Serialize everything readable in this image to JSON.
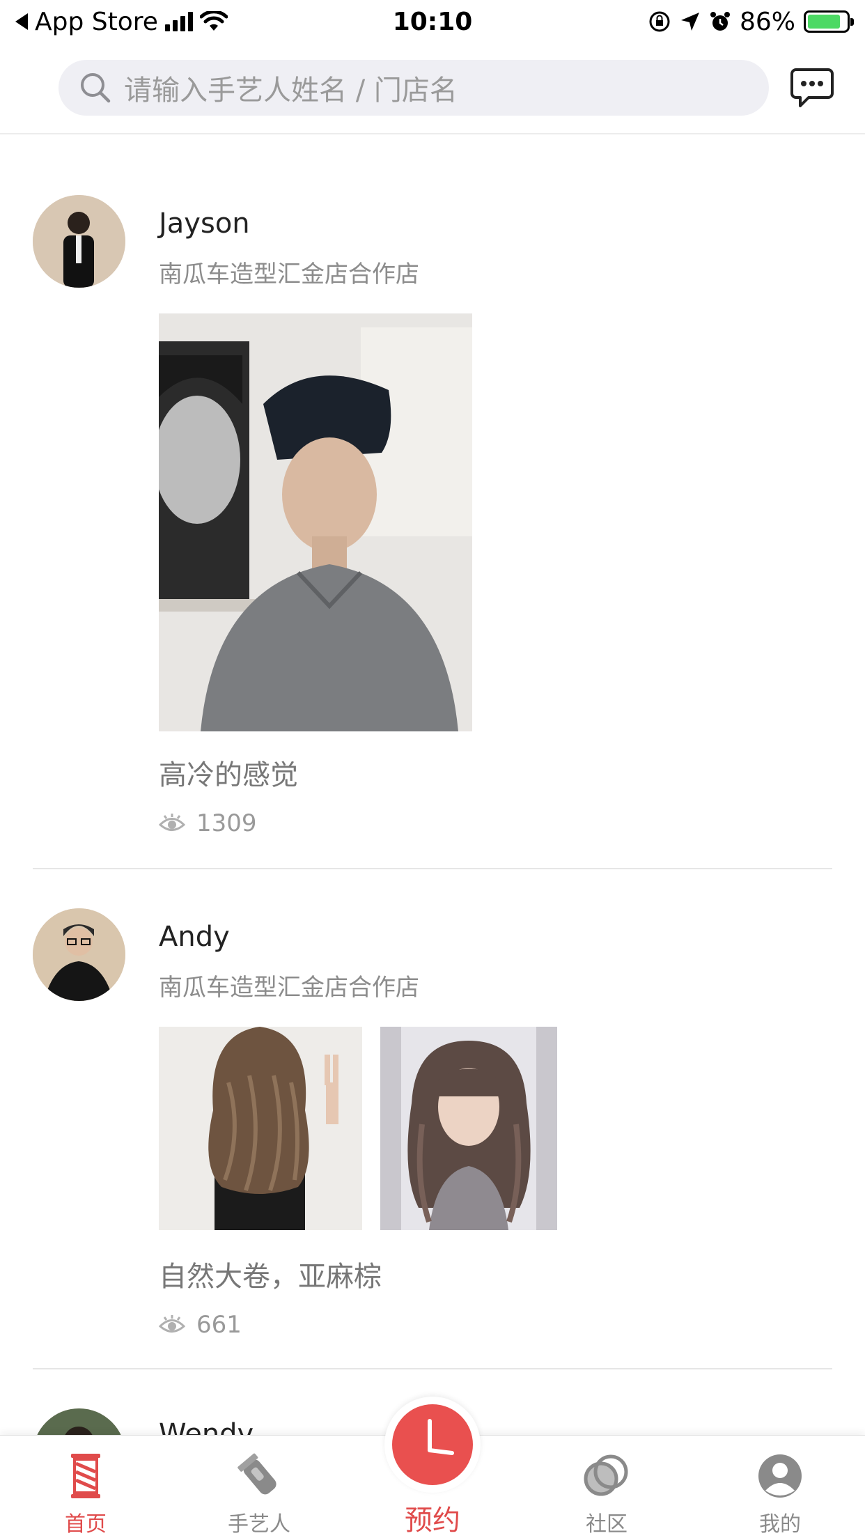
{
  "status_bar": {
    "back_app": "App Store",
    "time": "10:10",
    "battery": "86%",
    "battery_level": 0.86
  },
  "header": {
    "search_placeholder": "请输入手艺人姓名 / 门店名",
    "message_icon": "chat-bubble-icon"
  },
  "feed": [
    {
      "author": "Jayson",
      "shop": "南瓜车造型汇金店合作店",
      "caption": "高冷的感觉",
      "views": "1309"
    },
    {
      "author": "Andy",
      "shop": "南瓜车造型汇金店合作店",
      "caption": "自然大卷，亚麻棕",
      "views": "661"
    },
    {
      "author": "Wendy"
    }
  ],
  "tabbar": {
    "tabs": [
      {
        "label": "首页",
        "icon": "barber-pole-icon",
        "active": true
      },
      {
        "label": "手艺人",
        "icon": "clipper-icon",
        "active": false
      },
      {
        "label": "预约",
        "icon": "clock-icon",
        "active": false
      },
      {
        "label": "社区",
        "icon": "community-circles-icon",
        "active": false
      },
      {
        "label": "我的",
        "icon": "profile-icon",
        "active": false
      }
    ]
  },
  "colors": {
    "accent": "#e9504f",
    "search_bg": "#efeff4",
    "battery_green": "#4cd964"
  }
}
